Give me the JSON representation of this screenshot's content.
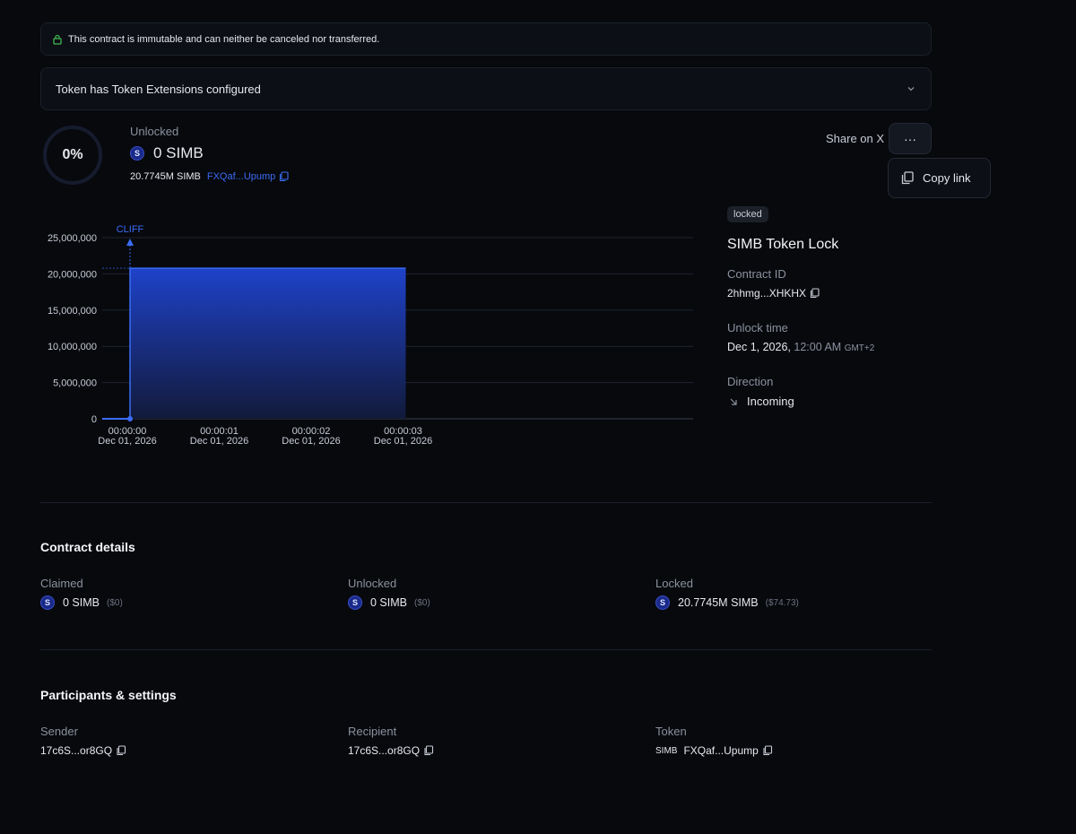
{
  "banner": {
    "text": "This contract is immutable and can neither be canceled nor transferred."
  },
  "extensions": {
    "text": "Token has Token Extensions configured"
  },
  "progress": {
    "percent_label": "0%",
    "fraction": 0
  },
  "summary": {
    "status_label": "Unlocked",
    "amount": "0 SIMB",
    "total": "20.7745M SIMB",
    "token_address": "FXQaf...Upump",
    "token_icon_letter": "S"
  },
  "actions": {
    "share_label": "Share on X",
    "more_label": "···",
    "copy_link_label": "Copy link"
  },
  "contract": {
    "badge": "locked",
    "title": "SIMB Token Lock",
    "id_label": "Contract ID",
    "id_value": "2hhmg...XHKHX",
    "unlock_label": "Unlock time",
    "unlock_date": "Dec 1, 2026,",
    "unlock_time": "12:00 AM",
    "unlock_tz": "GMT+2",
    "direction_label": "Direction",
    "direction_value": "Incoming"
  },
  "chart_data": {
    "type": "area",
    "annotation": "CLIFF",
    "ylim": [
      0,
      25000000
    ],
    "yticks": [
      "25,000,000",
      "20,000,000",
      "15,000,000",
      "10,000,000",
      "5,000,000",
      "0"
    ],
    "xticks": [
      {
        "time": "00:00:00",
        "date": "Dec 01, 2026"
      },
      {
        "time": "00:00:01",
        "date": "Dec 01, 2026"
      },
      {
        "time": "00:00:02",
        "date": "Dec 01, 2026"
      },
      {
        "time": "00:00:03",
        "date": "Dec 01, 2026"
      }
    ],
    "series": [
      {
        "x": [
          0,
          0,
          3
        ],
        "y": [
          0,
          20774500,
          20774500
        ]
      }
    ]
  },
  "details": {
    "title": "Contract details",
    "claimed": {
      "label": "Claimed",
      "amount": "0 SIMB",
      "usd": "($0)"
    },
    "unlocked": {
      "label": "Unlocked",
      "amount": "0 SIMB",
      "usd": "($0)"
    },
    "locked": {
      "label": "Locked",
      "amount": "20.7745M SIMB",
      "usd": "($74.73)"
    }
  },
  "participants": {
    "title": "Participants & settings",
    "sender": {
      "label": "Sender",
      "value": "17c6S...or8GQ"
    },
    "recipient": {
      "label": "Recipient",
      "value": "17c6S...or8GQ"
    },
    "token": {
      "label": "Token",
      "symbol": "SIMB",
      "value": "FXQaf...Upump"
    }
  }
}
